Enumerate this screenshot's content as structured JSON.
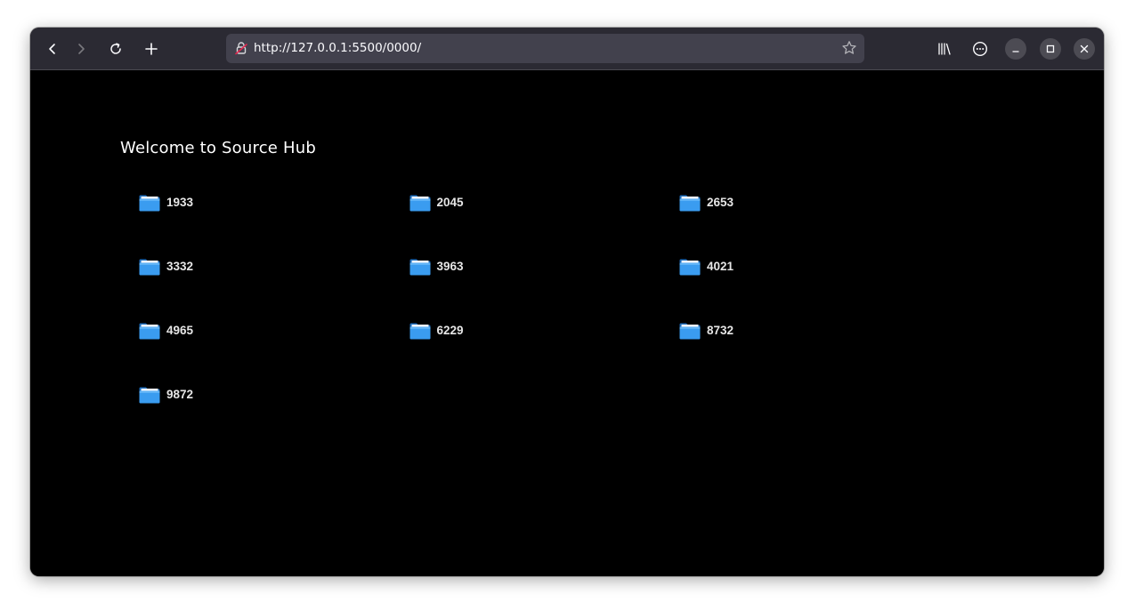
{
  "browser": {
    "url": "http://127.0.0.1:5500/0000/",
    "icons": {
      "back": "arrow-left-icon",
      "forward": "arrow-right-icon",
      "reload": "reload-icon",
      "new_tab": "plus-icon",
      "lock": "insecure-lock-icon",
      "bookmark": "star-icon",
      "library": "library-icon",
      "menu": "more-icon",
      "minimize": "minimize-icon",
      "maximize": "maximize-icon",
      "close": "close-icon"
    }
  },
  "page": {
    "title": "Welcome to Source Hub",
    "folders": [
      {
        "label": "1933"
      },
      {
        "label": "2045"
      },
      {
        "label": "2653"
      },
      {
        "label": "3332"
      },
      {
        "label": "3963"
      },
      {
        "label": "4021"
      },
      {
        "label": "4965"
      },
      {
        "label": "6229"
      },
      {
        "label": "8732"
      },
      {
        "label": "9872"
      }
    ]
  },
  "colors": {
    "page_background": "#000000",
    "toolbar_background": "#2b2a33",
    "urlbar_background": "#42414d",
    "folder_blue": "#3a9cf0",
    "text": "#e6e6e6"
  }
}
